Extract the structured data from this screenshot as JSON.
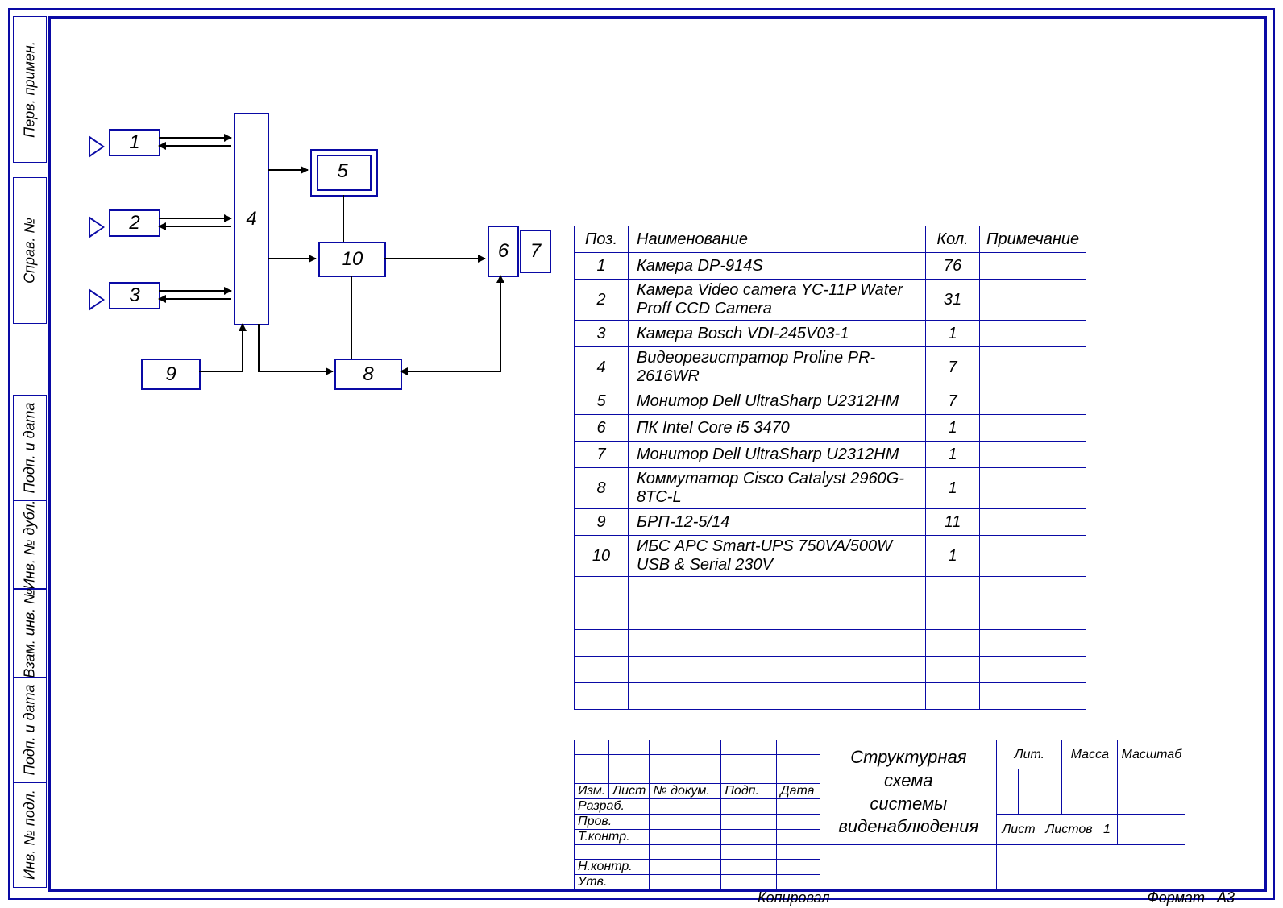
{
  "left_stamps": {
    "perv_primen": "Перв. примен.",
    "sprav_no": "Справ. №",
    "podp_data1": "Подп. и дата",
    "inv_dubl": "Инв. № дубл.",
    "vzam_inv": "Взам. инв. №",
    "podp_data2": "Подп. и дата",
    "inv_podl": "Инв. № подл."
  },
  "blocks": {
    "b1": "1",
    "b2": "2",
    "b3": "3",
    "b4": "4",
    "b5": "5",
    "b6": "6",
    "b7": "7",
    "b8": "8",
    "b9": "9",
    "b10": "10"
  },
  "parts_headers": {
    "pos": "Поз.",
    "name": "Наименование",
    "qty": "Кол.",
    "note": "Примечание"
  },
  "parts": [
    {
      "pos": "1",
      "name": "Камера DP-914S",
      "qty": "76",
      "note": ""
    },
    {
      "pos": "2",
      "name": "Камера Video camera YC-11P Water Proff CCD Camera",
      "qty": "31",
      "note": ""
    },
    {
      "pos": "3",
      "name": "Камера Bosch VDI-245V03-1",
      "qty": "1",
      "note": ""
    },
    {
      "pos": "4",
      "name": "Видеорегистратор Proline PR-2616WR",
      "qty": "7",
      "note": ""
    },
    {
      "pos": "5",
      "name": "Монитор Dell UltraSharp U2312HM",
      "qty": "7",
      "note": ""
    },
    {
      "pos": "6",
      "name": "ПК Intel Core i5 3470",
      "qty": "1",
      "note": ""
    },
    {
      "pos": "7",
      "name": "Монитор Dell UltraSharp U2312HM",
      "qty": "1",
      "note": ""
    },
    {
      "pos": "8",
      "name": "Коммутатор Cisco Catalyst 2960G-8TC-L",
      "qty": "1",
      "note": ""
    },
    {
      "pos": "9",
      "name": "БРП-12-5/14",
      "qty": "11",
      "note": ""
    },
    {
      "pos": "10",
      "name": "ИБС APC Smart-UPS 750VA/500W USB & Serial 230V",
      "qty": "1",
      "note": ""
    }
  ],
  "empty_rows": 5,
  "titleblock": {
    "row_labels": {
      "izm": "Изм.",
      "list": "Лист",
      "ndoc": "№ докум.",
      "podp": "Подп.",
      "data": "Дата",
      "razrab": "Разраб.",
      "prov": "Пров.",
      "tkontr": "Т.контр.",
      "nkontr": "Н.контр.",
      "utv": "Утв."
    },
    "title_line1": "Структурная схема",
    "title_line2": "системы виденаблюдения",
    "lit": "Лит.",
    "massa": "Масса",
    "mashtab": "Масштаб",
    "list2": "Лист",
    "listov": "Листов",
    "listov_val": "1",
    "kopiroval": "Копировал",
    "format": "Формат",
    "format_val": "А3"
  }
}
